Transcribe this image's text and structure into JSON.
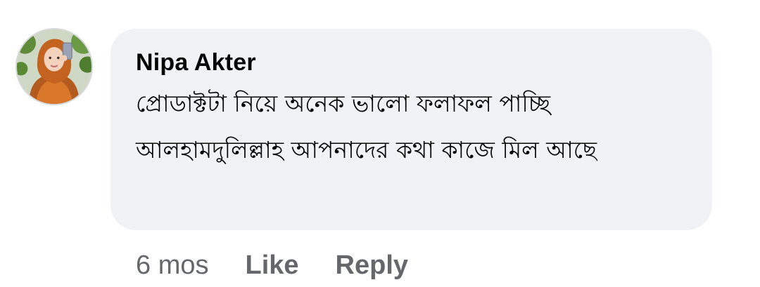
{
  "comment": {
    "author": "Nipa Akter",
    "text": "প্রোডাক্টটা নিয়ে অনেক ভালো ফলাফল পাচ্ছি আলহামদুলিল্লাহ আপনাদের কথা কাজে মিল আছে",
    "avatar_icon": "user-avatar-photo"
  },
  "actions": {
    "timestamp": "6 mos",
    "like_label": "Like",
    "reply_label": "Reply"
  },
  "colors": {
    "bubble": "#f0f2f5",
    "text": "#050505",
    "secondary": "#65676b"
  }
}
